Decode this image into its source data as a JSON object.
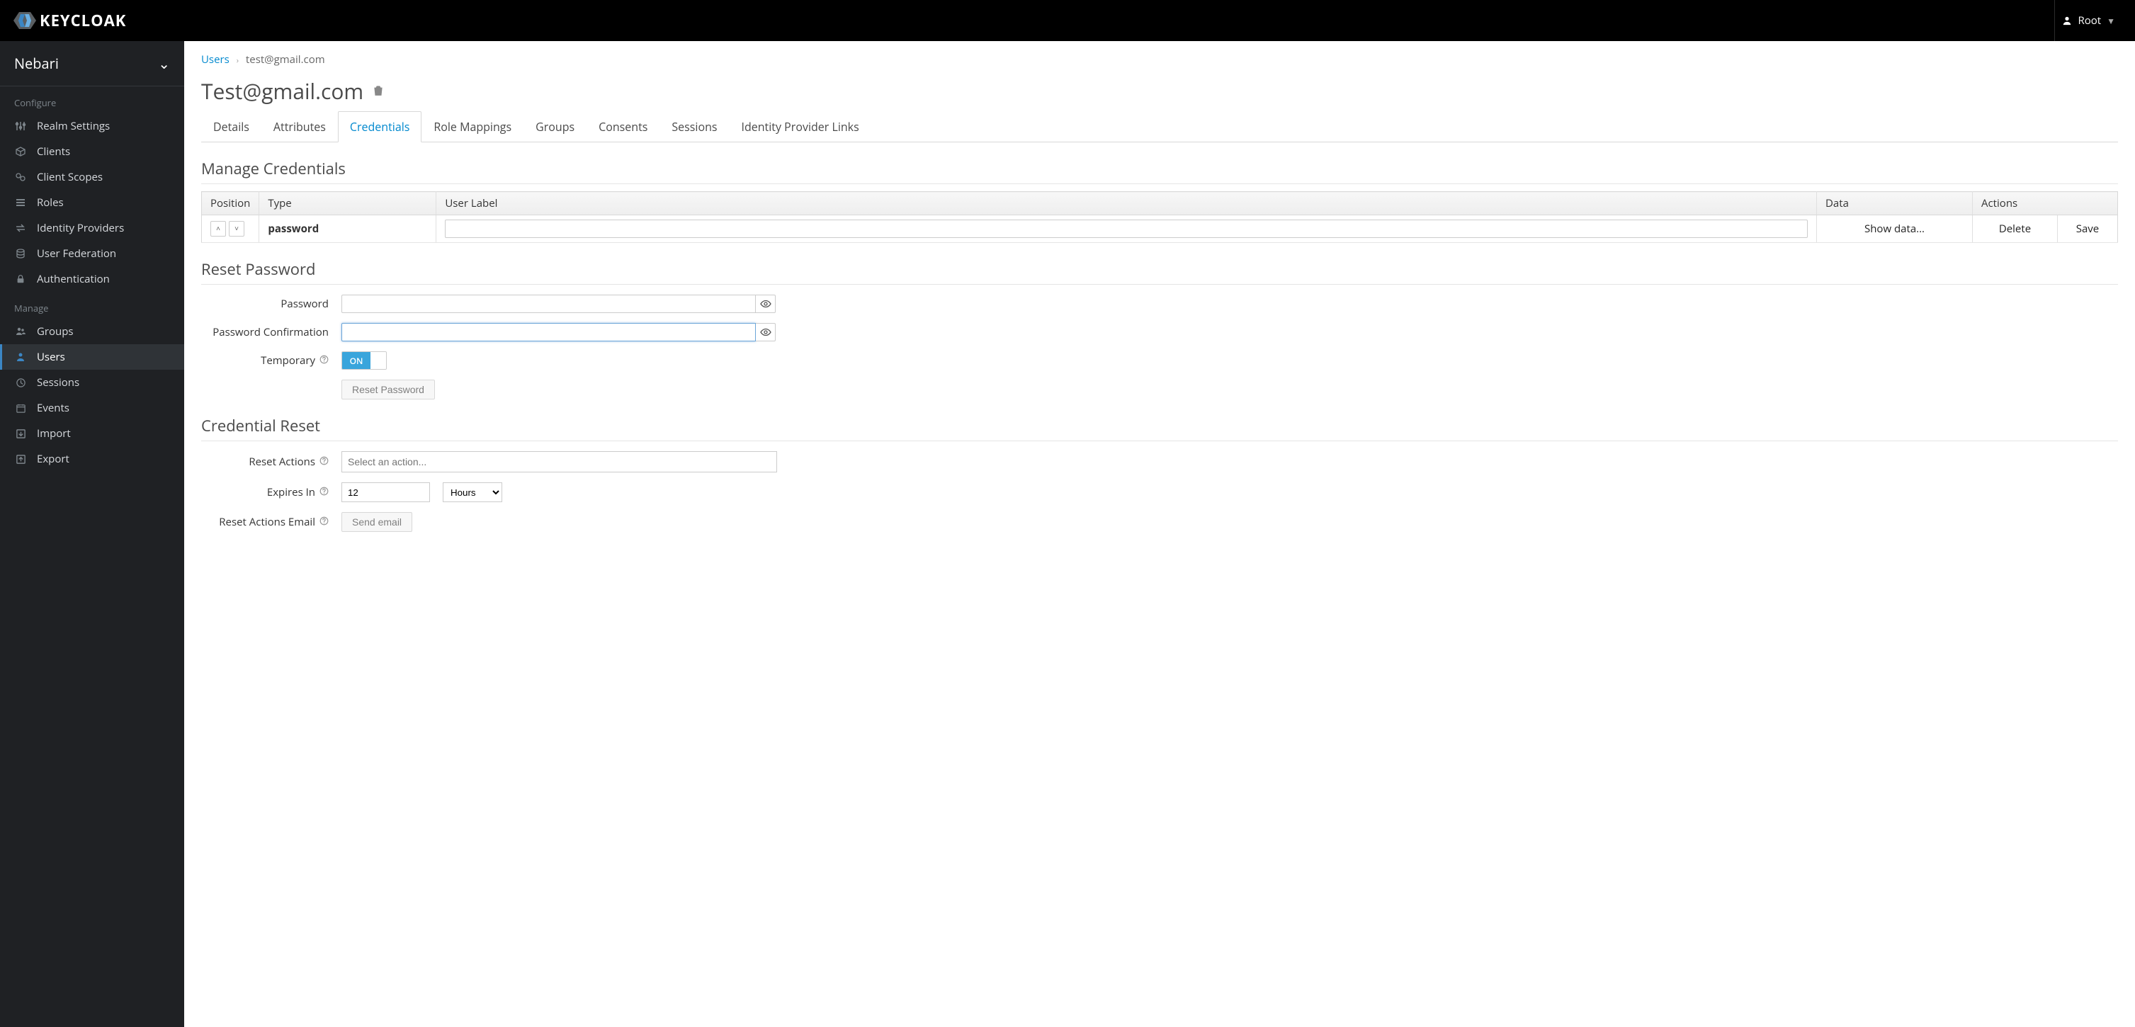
{
  "header": {
    "brand": "KEYCLOAK",
    "user_label": "Root"
  },
  "sidebar": {
    "realm": "Nebari",
    "section_configure": "Configure",
    "section_manage": "Manage",
    "configure_items": [
      {
        "label": "Realm Settings"
      },
      {
        "label": "Clients"
      },
      {
        "label": "Client Scopes"
      },
      {
        "label": "Roles"
      },
      {
        "label": "Identity Providers"
      },
      {
        "label": "User Federation"
      },
      {
        "label": "Authentication"
      }
    ],
    "manage_items": [
      {
        "label": "Groups"
      },
      {
        "label": "Users"
      },
      {
        "label": "Sessions"
      },
      {
        "label": "Events"
      },
      {
        "label": "Import"
      },
      {
        "label": "Export"
      }
    ]
  },
  "breadcrumb": {
    "parent": "Users",
    "current": "test@gmail.com"
  },
  "page": {
    "title": "Test@gmail.com"
  },
  "tabs": [
    {
      "label": "Details"
    },
    {
      "label": "Attributes"
    },
    {
      "label": "Credentials"
    },
    {
      "label": "Role Mappings"
    },
    {
      "label": "Groups"
    },
    {
      "label": "Consents"
    },
    {
      "label": "Sessions"
    },
    {
      "label": "Identity Provider Links"
    }
  ],
  "sections": {
    "manage_credentials": "Manage Credentials",
    "reset_password": "Reset Password",
    "credential_reset": "Credential Reset"
  },
  "cred_table": {
    "headers": {
      "position": "Position",
      "type": "Type",
      "user_label": "User Label",
      "data": "Data",
      "actions": "Actions"
    },
    "row": {
      "type": "password",
      "user_label_value": "",
      "show_data": "Show data...",
      "delete": "Delete",
      "save": "Save"
    }
  },
  "reset_pw": {
    "password_label": "Password",
    "confirm_label": "Password Confirmation",
    "temporary_label": "Temporary",
    "toggle_on": "ON",
    "reset_btn": "Reset Password"
  },
  "cred_reset": {
    "actions_label": "Reset Actions",
    "actions_placeholder": "Select an action...",
    "expires_label": "Expires In",
    "expires_value": "12",
    "expires_unit": "Hours",
    "email_label": "Reset Actions Email",
    "send_email_btn": "Send email"
  }
}
